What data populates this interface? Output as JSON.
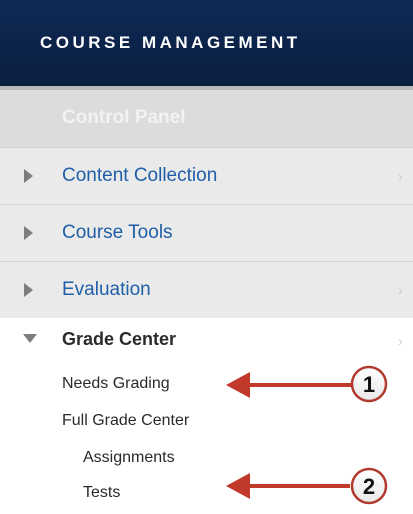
{
  "header": {
    "title": "COURSE MANAGEMENT"
  },
  "control_panel": {
    "label": "Control Panel"
  },
  "menu": [
    {
      "label": "Content Collection"
    },
    {
      "label": "Course Tools"
    },
    {
      "label": "Evaluation"
    }
  ],
  "grade_center": {
    "label": "Grade Center",
    "items": [
      {
        "label": "Needs Grading"
      },
      {
        "label": "Full Grade Center"
      },
      {
        "label": "Assignments"
      },
      {
        "label": "Tests"
      }
    ]
  },
  "callouts": [
    "1",
    "2"
  ],
  "colors": {
    "header": "#0a1e40",
    "link": "#1f5fa8",
    "arrow": "#c0392b"
  },
  "icons": [
    "triangle-right-icon",
    "triangle-down-icon",
    "chevron-right-icon",
    "arrow-left-icon"
  ]
}
